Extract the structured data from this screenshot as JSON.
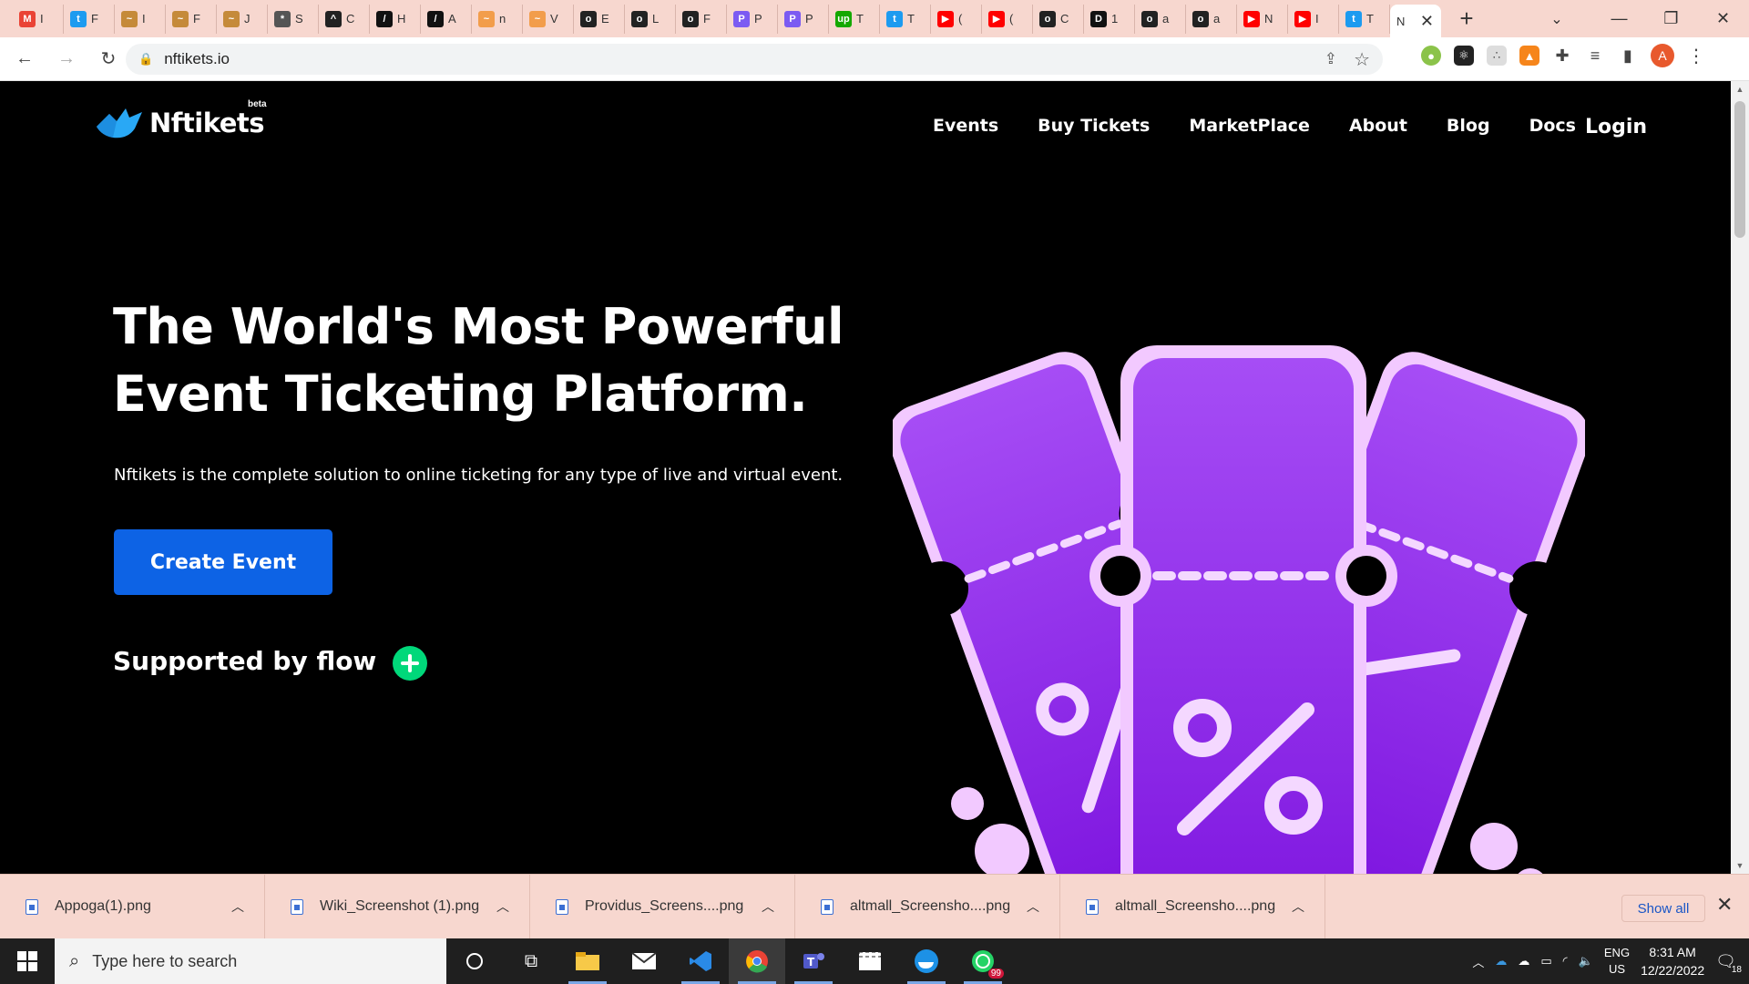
{
  "browser": {
    "tabs": [
      {
        "letter": "M",
        "color": "#ea4335",
        "label": "I"
      },
      {
        "letter": "t",
        "color": "#1d9bf0",
        "label": "F"
      },
      {
        "letter": "~",
        "color": "#c58a3a",
        "label": "I"
      },
      {
        "letter": "~",
        "color": "#c58a3a",
        "label": "F"
      },
      {
        "letter": "~",
        "color": "#c58a3a",
        "label": "J"
      },
      {
        "letter": "*",
        "color": "#555555",
        "label": "S"
      },
      {
        "letter": "^",
        "color": "#222222",
        "label": "C"
      },
      {
        "letter": "/",
        "color": "#111111",
        "label": "H"
      },
      {
        "letter": "/",
        "color": "#111111",
        "label": "A"
      },
      {
        "letter": "~",
        "color": "#f29d4b",
        "label": "n"
      },
      {
        "letter": "~",
        "color": "#f29d4b",
        "label": "V"
      },
      {
        "letter": "o",
        "color": "#222222",
        "label": "E"
      },
      {
        "letter": "o",
        "color": "#222222",
        "label": "L"
      },
      {
        "letter": "o",
        "color": "#222222",
        "label": "F"
      },
      {
        "letter": "P",
        "color": "#7b5bf2",
        "label": "P"
      },
      {
        "letter": "P",
        "color": "#7b5bf2",
        "label": "P"
      },
      {
        "letter": "up",
        "color": "#14a800",
        "label": "T"
      },
      {
        "letter": "t",
        "color": "#1d9bf0",
        "label": "T"
      },
      {
        "letter": "▶",
        "color": "#ff0000",
        "label": "("
      },
      {
        "letter": "▶",
        "color": "#ff0000",
        "label": "("
      },
      {
        "letter": "o",
        "color": "#222222",
        "label": "C"
      },
      {
        "letter": "D",
        "color": "#111111",
        "label": "1"
      },
      {
        "letter": "o",
        "color": "#222222",
        "label": "a"
      },
      {
        "letter": "o",
        "color": "#222222",
        "label": "a"
      },
      {
        "letter": "▶",
        "color": "#ff0000",
        "label": "N"
      },
      {
        "letter": "▶",
        "color": "#ff0000",
        "label": "I"
      },
      {
        "letter": "t",
        "color": "#1d9bf0",
        "label": "T"
      }
    ],
    "active_tab_label": "N",
    "new_tab": "+",
    "url": "nftikets.io"
  },
  "site": {
    "brand": "Nftikets",
    "beta": "beta",
    "nav": [
      "Events",
      "Buy Tickets",
      "MarketPlace",
      "About",
      "Blog",
      "Docs"
    ],
    "login": "Login",
    "hero_title_line1": "The World's Most Powerful",
    "hero_title_line2": "Event Ticketing Platform.",
    "hero_subtitle": "Nftikets is the complete solution to online ticketing for any type of live and virtual event.",
    "cta": "Create Event",
    "supported": "Supported by flow",
    "accent": "#0d63e5",
    "ticket_color": "#8a2be2",
    "flow_color": "#00d87a"
  },
  "downloads": {
    "items": [
      "Appoga(1).png",
      "Wiki_Screenshot (1).png",
      "Providus_Screens....png",
      "altmall_Screensho....png",
      "altmall_Screensho....png"
    ],
    "show_all": "Show all"
  },
  "taskbar": {
    "search_placeholder": "Type here to search",
    "whatsapp_badge": "99",
    "lang": "ENG",
    "region": "US",
    "time": "8:31 AM",
    "date": "12/22/2022",
    "notifications": "18"
  }
}
